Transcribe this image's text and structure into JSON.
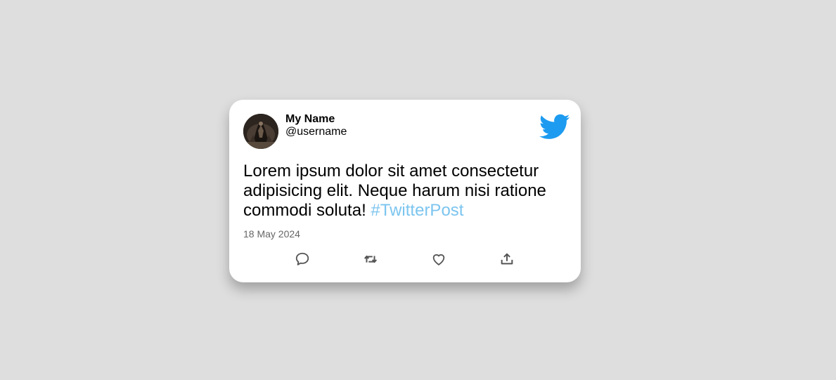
{
  "tweet": {
    "display_name": "My Name",
    "username": "@username",
    "text": "Lorem ipsum dolor sit amet consectetur adipisicing elit. Neque harum nisi ratione commodi soluta! ",
    "hashtag": "#TwitterPost",
    "date": "18 May 2024"
  },
  "icons": {
    "brand": "twitter-bird-icon",
    "actions": [
      "comment-icon",
      "retweet-icon",
      "like-icon",
      "share-icon"
    ]
  },
  "colors": {
    "background": "#dedede",
    "card": "#ffffff",
    "brand_blue": "#1d9bf0",
    "hashtag": "#7cc5ef",
    "date": "#666666",
    "action_icon": "#555555"
  }
}
